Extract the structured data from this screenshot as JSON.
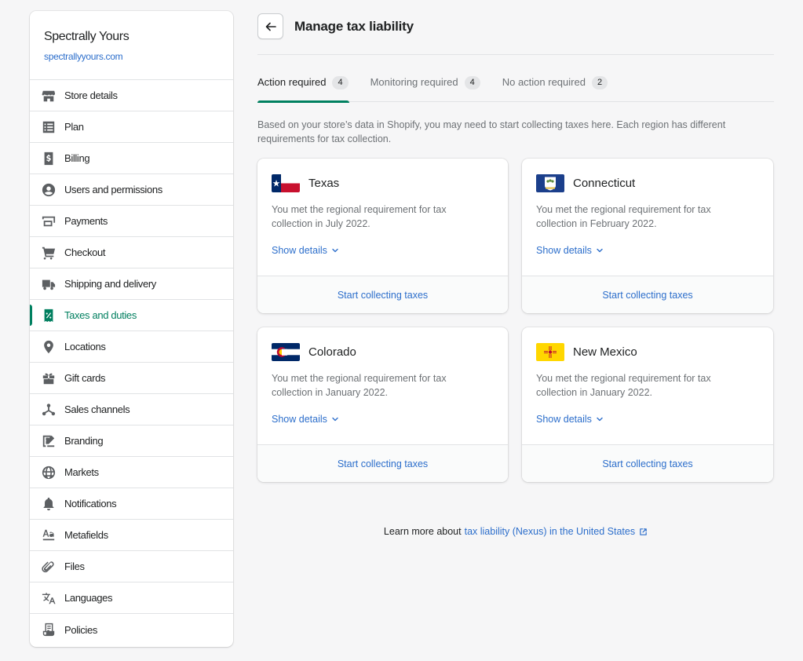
{
  "store": {
    "name": "Spectrally Yours",
    "url": "spectrallyyours.com"
  },
  "sidebar": {
    "items": [
      {
        "label": "Store details",
        "icon": "store-icon"
      },
      {
        "label": "Plan",
        "icon": "plan-icon"
      },
      {
        "label": "Billing",
        "icon": "billing-icon"
      },
      {
        "label": "Users and permissions",
        "icon": "user-icon"
      },
      {
        "label": "Payments",
        "icon": "payments-icon"
      },
      {
        "label": "Checkout",
        "icon": "cart-icon"
      },
      {
        "label": "Shipping and delivery",
        "icon": "truck-icon"
      },
      {
        "label": "Taxes and duties",
        "icon": "tax-icon",
        "active": true
      },
      {
        "label": "Locations",
        "icon": "location-pin-icon"
      },
      {
        "label": "Gift cards",
        "icon": "gift-icon"
      },
      {
        "label": "Sales channels",
        "icon": "channels-icon"
      },
      {
        "label": "Branding",
        "icon": "branding-icon"
      },
      {
        "label": "Markets",
        "icon": "globe-icon"
      },
      {
        "label": "Notifications",
        "icon": "bell-icon"
      },
      {
        "label": "Metafields",
        "icon": "metafields-icon"
      },
      {
        "label": "Files",
        "icon": "paperclip-icon"
      },
      {
        "label": "Languages",
        "icon": "translate-icon"
      },
      {
        "label": "Policies",
        "icon": "policy-icon"
      }
    ]
  },
  "header": {
    "title": "Manage tax liability"
  },
  "tabs": [
    {
      "label": "Action required",
      "count": "4",
      "selected": true
    },
    {
      "label": "Monitoring required",
      "count": "4"
    },
    {
      "label": "No action required",
      "count": "2"
    }
  ],
  "intro": "Based on your store’s data in Shopify, you may need to start collecting taxes here. Each region has different requirements for tax collection.",
  "cards": [
    {
      "region": "Texas",
      "text": "You met the regional requirement for tax collection in July 2022.",
      "details": "Show details",
      "action": "Start collecting taxes",
      "flag": "texas-flag-icon"
    },
    {
      "region": "Connecticut",
      "text": "You met the regional requirement for tax collection in February 2022.",
      "details": "Show details",
      "action": "Start collecting taxes",
      "flag": "connecticut-flag-icon"
    },
    {
      "region": "Colorado",
      "text": "You met the regional requirement for tax collection in January 2022.",
      "details": "Show details",
      "action": "Start collecting taxes",
      "flag": "colorado-flag-icon"
    },
    {
      "region": "New Mexico",
      "text": "You met the regional requirement for tax collection in January 2022.",
      "details": "Show details",
      "action": "Start collecting taxes",
      "flag": "new-mexico-flag-icon"
    }
  ],
  "footer": {
    "prefix": "Learn more about",
    "link": "tax liability (Nexus) in the United States"
  },
  "colors": {
    "accent": "#008060",
    "link": "#2c6ecb"
  }
}
